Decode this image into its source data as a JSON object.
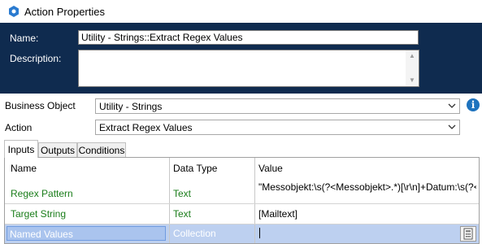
{
  "window": {
    "title": "Action Properties"
  },
  "header": {
    "name_label": "Name:",
    "name_value": "Utility - Strings::Extract Regex Values",
    "description_label": "Description:",
    "description_value": ""
  },
  "form": {
    "business_object_label": "Business Object",
    "business_object_value": "Utility - Strings",
    "action_label": "Action",
    "action_value": "Extract Regex Values"
  },
  "tabs": [
    {
      "label": "Inputs",
      "active": true
    },
    {
      "label": "Outputs",
      "active": false
    },
    {
      "label": "Conditions",
      "active": false
    }
  ],
  "grid": {
    "columns": [
      "Name",
      "Data Type",
      "Value"
    ],
    "rows": [
      {
        "name": "Regex Pattern",
        "type": "Text",
        "value": "\"Messobjekt:\\s(?<Messobjekt>.*)[\\r\\n]+Datum:\\s(?<D"
      },
      {
        "name": "Target String",
        "type": "Text",
        "value": "[Mailtext]"
      },
      {
        "name": "Named Values",
        "type": "Collection",
        "value": ""
      }
    ]
  },
  "icons": {
    "app": "gear-icon",
    "info": "info-icon",
    "dropdown": "chevron-down-icon",
    "calculator": "calculator-icon"
  },
  "colors": {
    "header_bg": "#0f2b4f",
    "accent": "#1e73be",
    "param_name": "#1a7d1a",
    "selection": "#bdd0f0"
  }
}
